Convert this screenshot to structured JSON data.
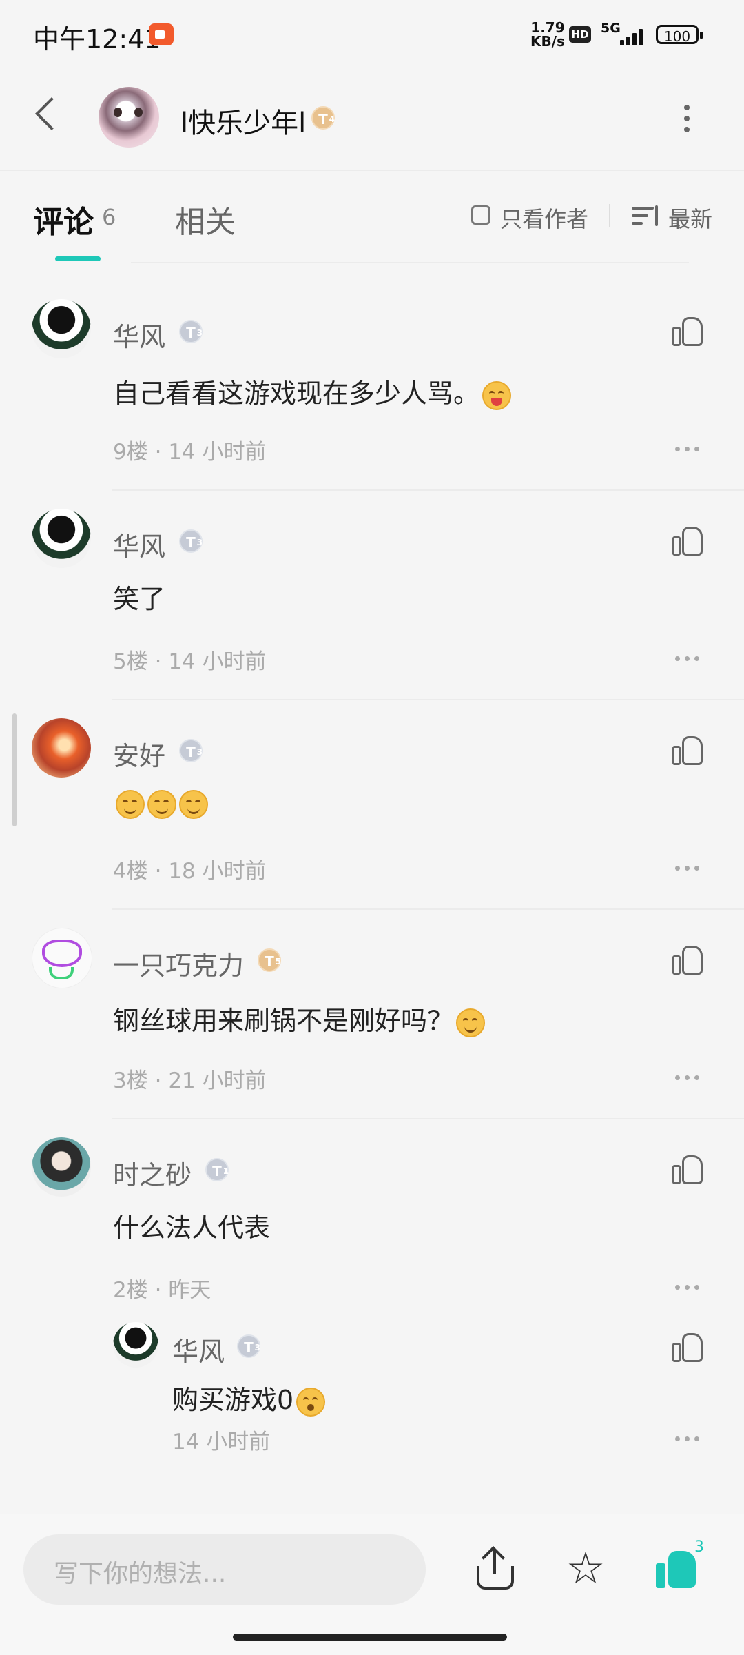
{
  "status_bar": {
    "time": "中午12:41",
    "speed_value": "1.79",
    "speed_unit": "KB/s",
    "hd": "HD",
    "network": "5G",
    "battery": "100"
  },
  "header": {
    "username": "l快乐少年l",
    "level_badge": "T",
    "level_num": "4"
  },
  "tabs": {
    "comments_label": "评论",
    "comments_count": "6",
    "related_label": "相关",
    "author_only_label": "只看作者",
    "sort_label": "最新"
  },
  "comments": [
    {
      "user": "华风",
      "badge": "T",
      "level": "3",
      "text": "自己看看这游戏现在多少人骂。",
      "floor": "9楼",
      "time": "14 小时前"
    },
    {
      "user": "华风",
      "badge": "T",
      "level": "3",
      "text": "笑了",
      "floor": "5楼",
      "time": "14 小时前"
    },
    {
      "user": "安好",
      "badge": "T",
      "level": "3",
      "text": "",
      "floor": "4楼",
      "time": "18 小时前"
    },
    {
      "user": "一只巧克力",
      "badge": "T",
      "level": "5",
      "text": "钢丝球用来刷锅不是刚好吗？",
      "floor": "3楼",
      "time": "21 小时前"
    },
    {
      "user": "时之砂",
      "badge": "T",
      "level": "1",
      "text": "什么法人代表",
      "floor": "2楼",
      "time": "昨天"
    }
  ],
  "reply": {
    "user": "华风",
    "badge": "T",
    "level": "3",
    "text": "购买游戏0",
    "time": "14 小时前"
  },
  "meta_separator": "·",
  "bottom_bar": {
    "input_placeholder": "写下你的想法...",
    "like_count": "3"
  },
  "colors": {
    "accent": "#1ec8b8",
    "background": "#f5f5f5"
  },
  "icons": [
    "back-icon",
    "more-vertical-icon",
    "checkbox-icon",
    "sort-icon",
    "like-icon",
    "more-horizontal-icon",
    "share-icon",
    "star-icon",
    "emoji-icon"
  ]
}
